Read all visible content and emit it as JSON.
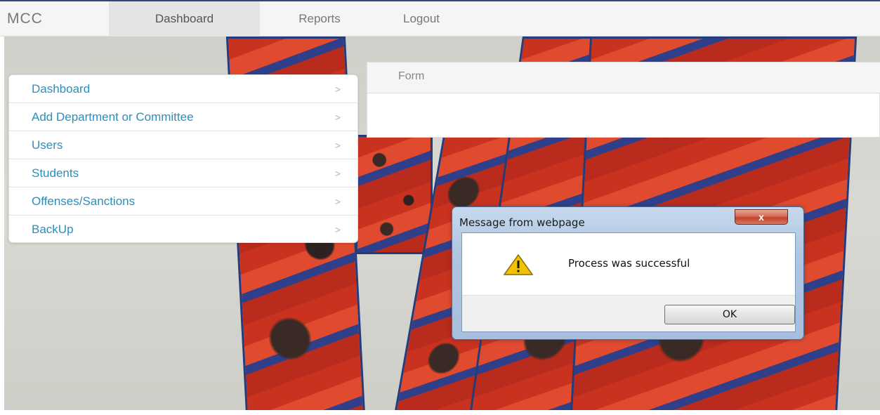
{
  "navbar": {
    "brand": "MCC",
    "links": [
      {
        "label": "Dashboard",
        "active": true
      },
      {
        "label": "Reports",
        "active": false
      },
      {
        "label": "Logout",
        "active": false
      }
    ]
  },
  "side_menu": {
    "items": [
      {
        "label": "Dashboard",
        "chevron": ">"
      },
      {
        "label": "Add Department or Committee",
        "chevron": ">"
      },
      {
        "label": "Users",
        "chevron": ">"
      },
      {
        "label": "Students",
        "chevron": ">"
      },
      {
        "label": "Offenses/Sanctions",
        "chevron": ">"
      },
      {
        "label": "BackUp",
        "chevron": ">"
      }
    ]
  },
  "form_panel": {
    "title": "Form"
  },
  "dialog": {
    "title": "Message from webpage",
    "close_label": "x",
    "icon": "warning-icon",
    "message": "Process was successful",
    "ok_label": "OK"
  },
  "colors": {
    "link": "#2a8fbd",
    "navbar_bg": "#f5f5f5",
    "dialog_frame": "#aec6e2",
    "close_button": "#c2402c"
  }
}
